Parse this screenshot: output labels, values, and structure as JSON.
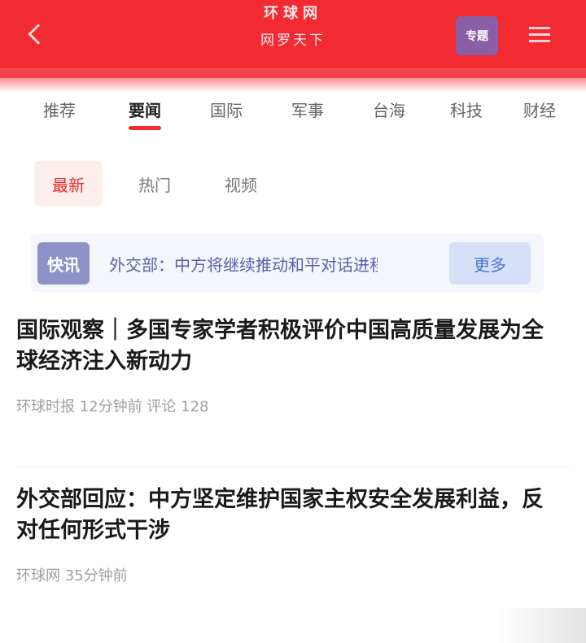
{
  "header": {
    "brand": "环球网",
    "subtitle": "网罗天下",
    "promo_label": "专题",
    "colors": {
      "primary": "#f22a32",
      "accent": "#8a5fa8"
    },
    "icons": {
      "back": "chevron-left-icon",
      "menu": "menu-icon"
    }
  },
  "channel_tabs": [
    {
      "label": "推荐",
      "active": false
    },
    {
      "label": "要闻",
      "active": true
    },
    {
      "label": "国际",
      "active": false
    },
    {
      "label": "军事",
      "active": false
    },
    {
      "label": "台海",
      "active": false
    },
    {
      "label": "科技",
      "active": false
    },
    {
      "label": "财经",
      "active": false
    }
  ],
  "sub_tabs": [
    {
      "label": "最新",
      "active": true
    },
    {
      "label": "热门",
      "active": false
    },
    {
      "label": "视频",
      "active": false
    }
  ],
  "notice": {
    "tag": "快讯",
    "text": "外交部：中方将继续推动和平对话进程",
    "more": "更多"
  },
  "news": [
    {
      "title": "国际观察｜多国专家学者积极评价中国高质量发展为全球经济注入新动力",
      "meta": "环球时报  12分钟前  评论 128"
    },
    {
      "title": "外交部回应：中方坚定维护国家主权安全发展利益，反对任何形式干涉",
      "meta": "环球网  35分钟前"
    }
  ]
}
